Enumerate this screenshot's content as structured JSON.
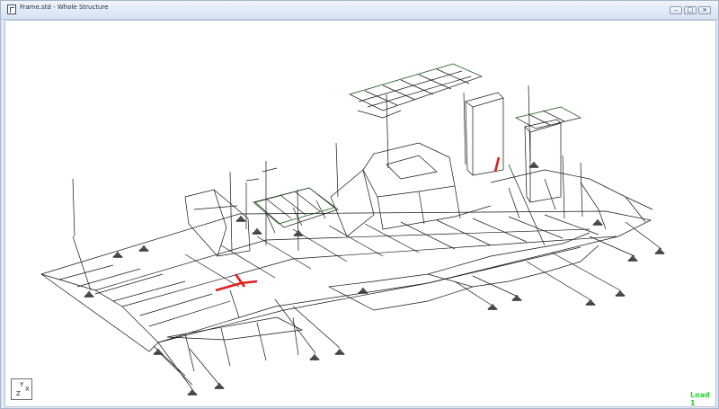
{
  "window": {
    "title": "Frame.std - Whole Structure",
    "controls": {
      "minimize": "–",
      "maximize": "□",
      "close": "×"
    }
  },
  "viewport": {
    "axis_triad": {
      "y": "Y",
      "x": "X",
      "z": "Z"
    },
    "load_case": "Load 1",
    "colors": {
      "members": "#141414",
      "plates": "#1f9c1f",
      "selected_members": "#e02020",
      "load_label": "#2cd12c"
    }
  },
  "icons": {
    "app": "structure-doc-icon",
    "support": "pinned-support-icon"
  }
}
